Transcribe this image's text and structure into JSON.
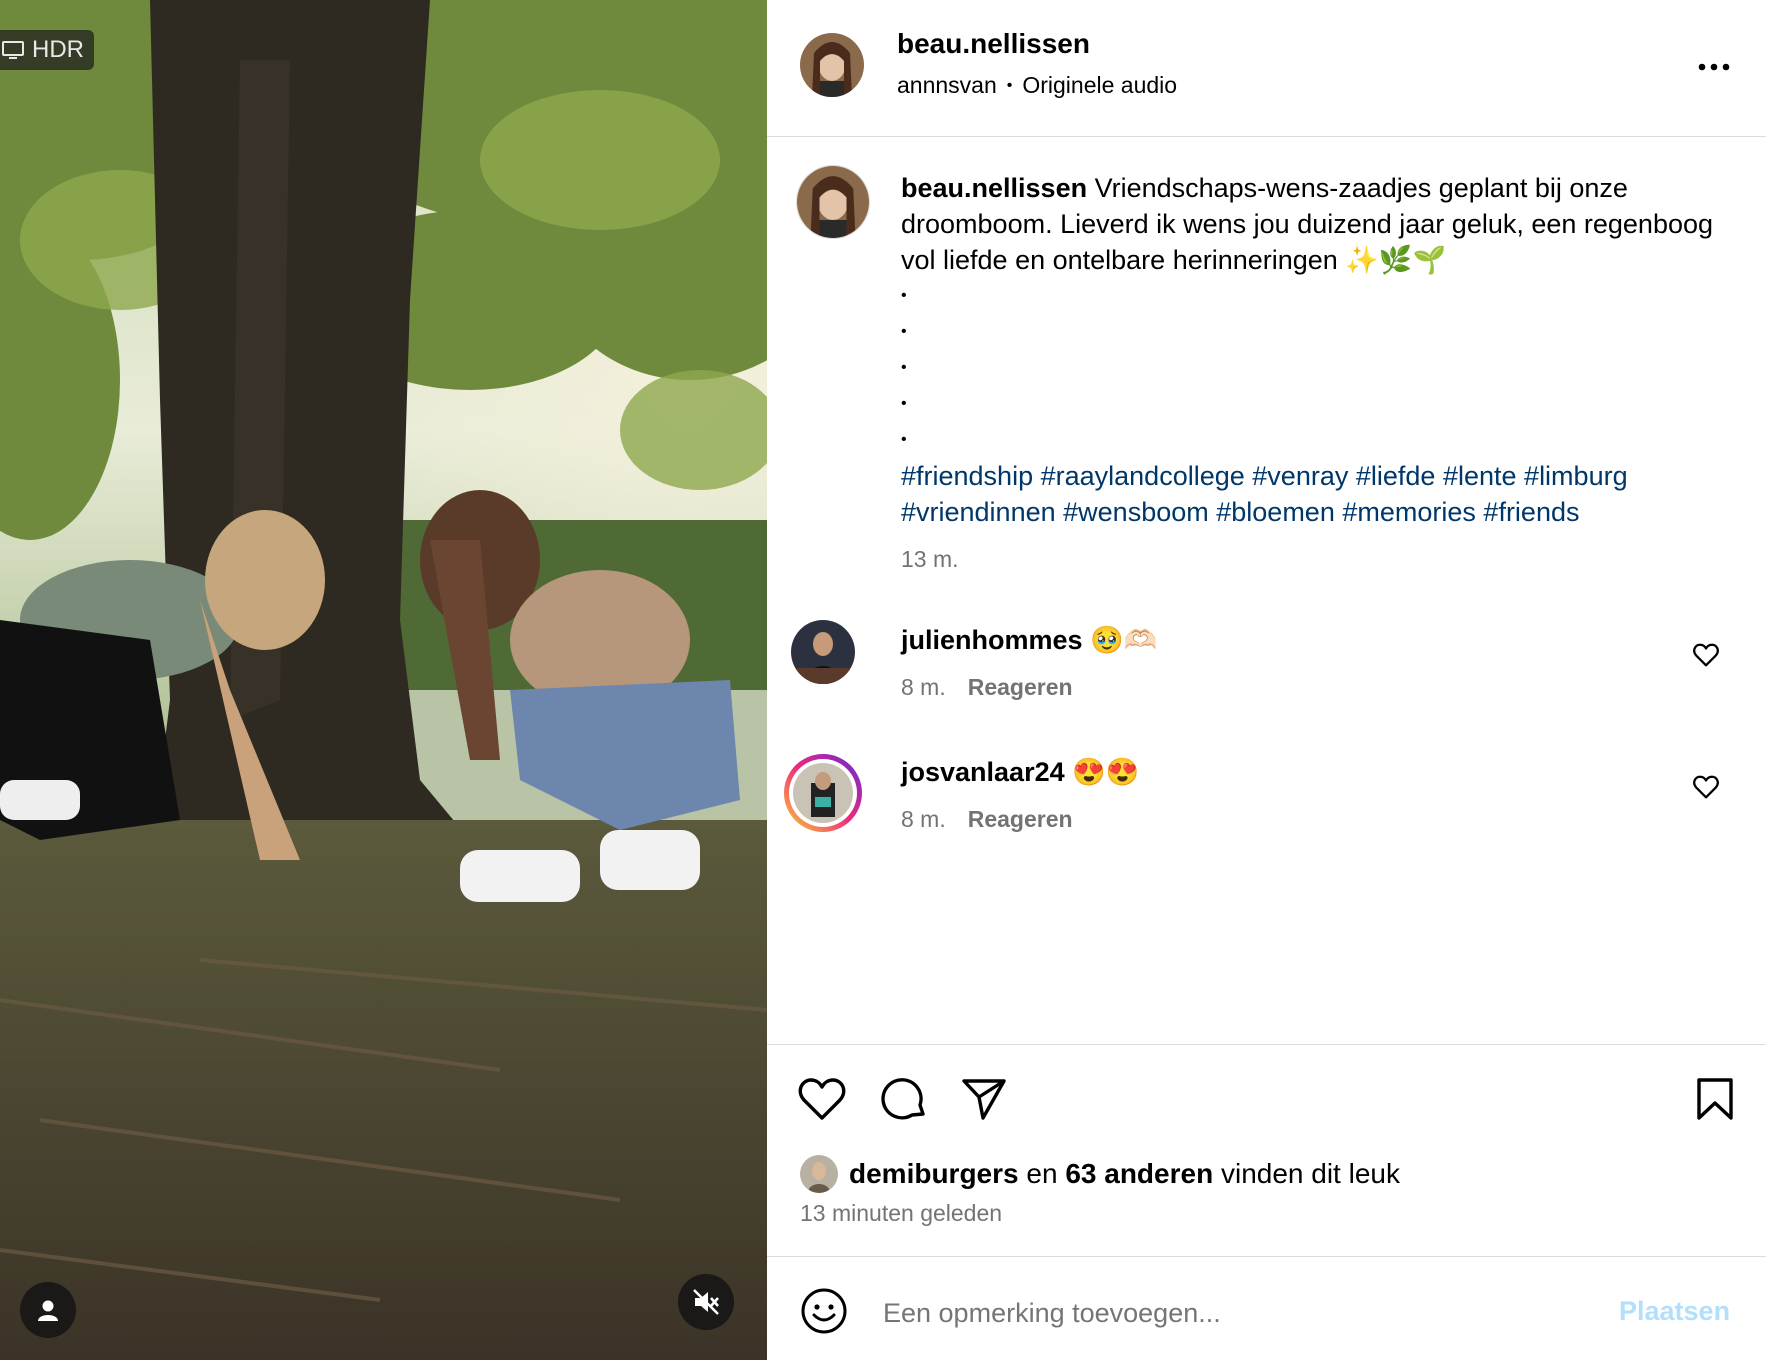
{
  "media": {
    "hdr_label": "HDR"
  },
  "header": {
    "username": "beau.nellissen",
    "audio_owner": "annnsvan",
    "separator": "•",
    "audio_label": "Originele audio"
  },
  "caption": {
    "username": "beau.nellissen",
    "text": "Vriendschaps-wens-zaadjes geplant bij onze droomboom. Lieverd ik wens jou duizend jaar geluk, een regenboog vol liefde en ontelbare herinneringen ✨🌿🌱",
    "dots": [
      "•",
      "•",
      "•",
      "•",
      "•"
    ],
    "hashtags": [
      "#friendship",
      "#raaylandcollege",
      "#venray",
      "#liefde",
      "#lente",
      "#limburg",
      "#vriendinnen",
      "#wensboom",
      "#bloemen",
      "#memories",
      "#friends"
    ],
    "time": "13 m."
  },
  "comments": [
    {
      "username": "julienhommes",
      "text": "🥹🫶🏻",
      "time": "8 m.",
      "reply": "Reageren"
    },
    {
      "username": "josvanlaar24",
      "text": "😍😍",
      "time": "8 m.",
      "reply": "Reageren"
    }
  ],
  "likes": {
    "liker": "demiburgers",
    "connector": "en",
    "others": "63 anderen",
    "suffix": "vinden dit leuk",
    "timestamp": "13 minuten geleden"
  },
  "composer": {
    "placeholder": "Een opmerking toevoegen...",
    "post_label": "Plaatsen"
  },
  "colors": {
    "hashtag": "#00376b",
    "secondary_text": "#737373",
    "post_button_disabled": "#b2dffc",
    "story_ring": "#d6249f"
  }
}
